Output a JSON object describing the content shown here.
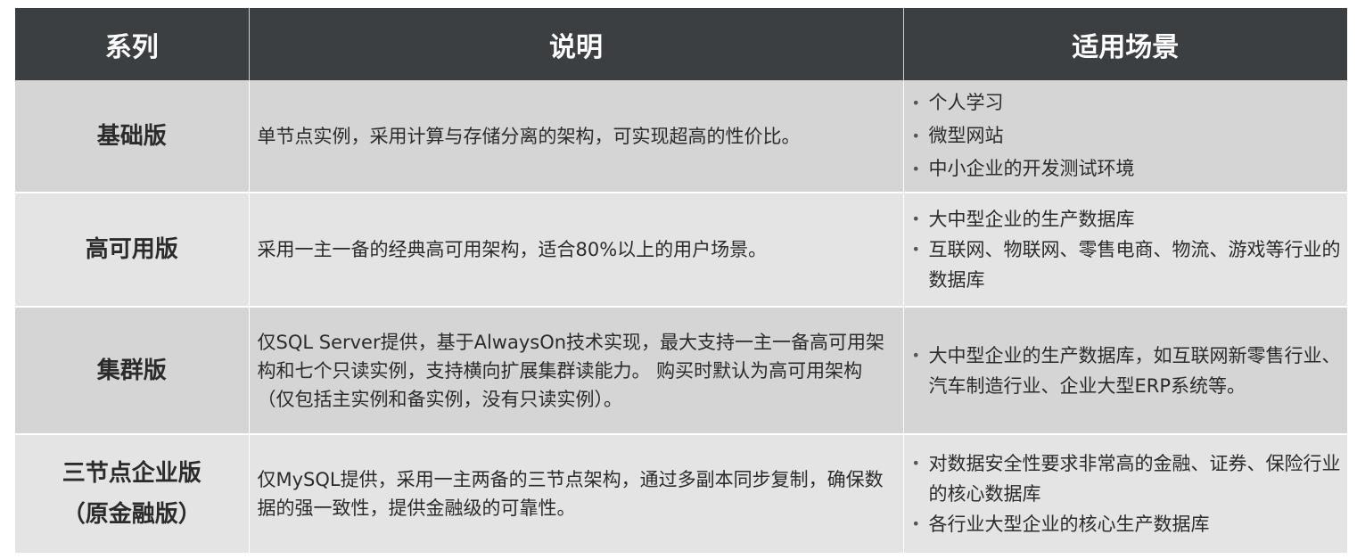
{
  "header": {
    "col1": "系列",
    "col2": "说明",
    "col3": "适用场景"
  },
  "rows": [
    {
      "series": [
        "基础版"
      ],
      "desc": "单节点实例，采用计算与存储分离的架构，可实现超高的性价比。",
      "scenes": [
        "个人学习",
        "微型网站",
        "中小企业的开发测试环境"
      ]
    },
    {
      "series": [
        "高可用版"
      ],
      "desc": "采用一主一备的经典高可用架构，适合80%以上的用户场景。",
      "scenes": [
        "大中型企业的生产数据库",
        "互联网、物联网、零售电商、物流、游戏等行业的数据库"
      ]
    },
    {
      "series": [
        "集群版"
      ],
      "desc": "仅SQL Server提供，基于AlwaysOn技术实现，最大支持一主一备高可用架构和七个只读实例，支持横向扩展集群读能力。 购买时默认为高可用架构（仅包括主实例和备实例，没有只读实例）。",
      "scenes": [
        "大中型企业的生产数据库，如互联网新零售行业、汽车制造行业、企业大型ERP系统等。"
      ]
    },
    {
      "series": [
        "三节点企业版",
        "（原金融版）"
      ],
      "desc": "仅MySQL提供，采用一主两备的三节点架构，通过多副本同步复制，确保数据的强一致性，提供金融级的可靠性。",
      "scenes": [
        "对数据安全性要求非常高的金融、证券、保险行业的核心数据库",
        "各行业大型企业的核心生产数据库"
      ]
    }
  ],
  "bullet_glyph": "•"
}
